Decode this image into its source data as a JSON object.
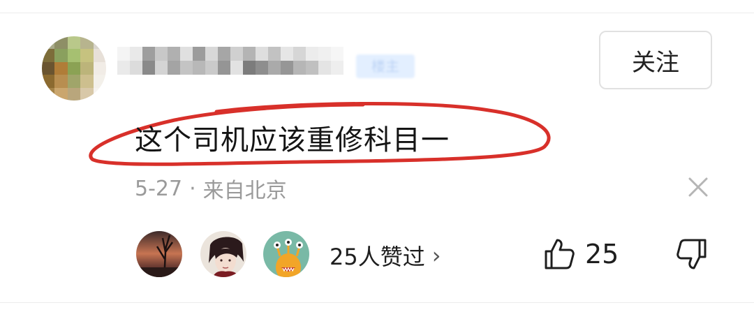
{
  "comment": {
    "text": "这个司机应该重修科目一",
    "date": "5-27",
    "separator": "·",
    "location": "来自北京"
  },
  "author": {
    "tag_label": "楼主"
  },
  "follow_button": {
    "label": "关注"
  },
  "likes": {
    "summary": "25人赞过",
    "chevron": "›",
    "count": "25"
  },
  "icons": {
    "close": "close-icon",
    "like": "thumbs-up-icon",
    "dislike": "thumbs-down-icon",
    "chevron": "chevron-right-icon"
  },
  "colors": {
    "annotation": "#d8302a",
    "tag_bg": "#e3efff",
    "meta_text": "#9a9a9a"
  }
}
